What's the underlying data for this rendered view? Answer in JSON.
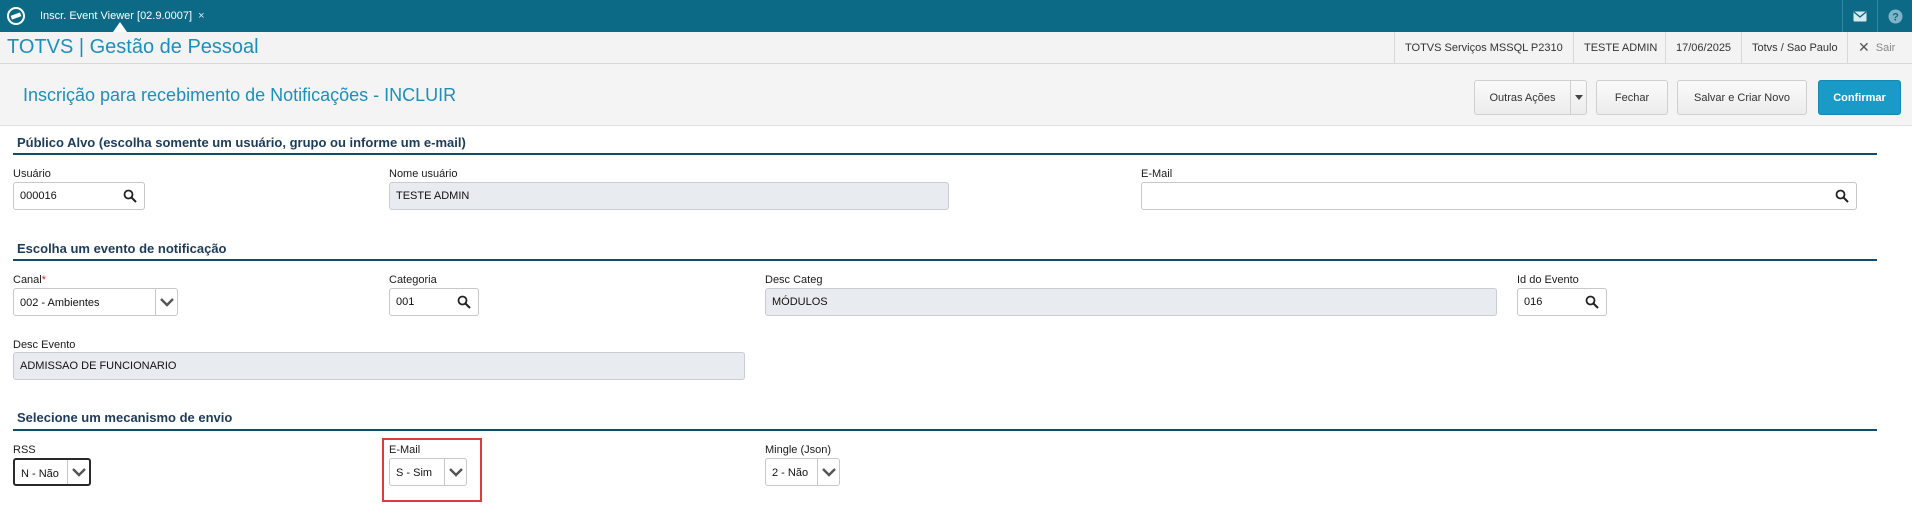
{
  "topbar": {
    "tab_label": "Inscr. Event Viewer [02.9.0007]",
    "tab_close": "×"
  },
  "header": {
    "app_title": "TOTVS | Gestão de Pessoal",
    "environment": "TOTVS Serviços MSSQL P2310",
    "user": "TESTE ADMIN",
    "date": "17/06/2025",
    "branch": "Totvs / Sao Paulo",
    "logout_label": "Sair"
  },
  "page": {
    "title": "Inscrição para recebimento de Notificações - INCLUIR",
    "actions": {
      "more_actions": "Outras Ações",
      "close": "Fechar",
      "save_new": "Salvar e Criar Novo",
      "confirm": "Confirmar"
    }
  },
  "sections": {
    "target": {
      "title": "Público Alvo (escolha somente um usuário, grupo ou informe um e-mail)",
      "usuario_label": "Usuário",
      "usuario_value": "000016",
      "nome_label": "Nome usuário",
      "nome_value": "TESTE ADMIN",
      "email_label": "E-Mail",
      "email_value": ""
    },
    "event": {
      "title": "Escolha um evento de notificação",
      "canal_label": "Canal",
      "canal_required": "*",
      "canal_value": "002 - Ambientes",
      "categoria_label": "Categoria",
      "categoria_value": "001",
      "desc_categ_label": "Desc Categ",
      "desc_categ_value": "MÓDULOS",
      "id_evento_label": "Id do Evento",
      "id_evento_value": "016",
      "desc_evento_label": "Desc Evento",
      "desc_evento_value": "ADMISSAO DE FUNCIONARIO"
    },
    "mechanism": {
      "title": "Selecione um mecanismo de envio",
      "rss_label": "RSS",
      "rss_value": "N - Não",
      "email_label": "E-Mail",
      "email_value": "S - Sim",
      "mingle_label": "Mingle (Json)",
      "mingle_value": "2 - Não"
    }
  },
  "colors": {
    "topbar": "#0d6a86",
    "accent": "#1d8fbd",
    "primary_button": "#1a9bc7",
    "section_line": "#0d4f66",
    "highlight": "#e03b3b"
  }
}
